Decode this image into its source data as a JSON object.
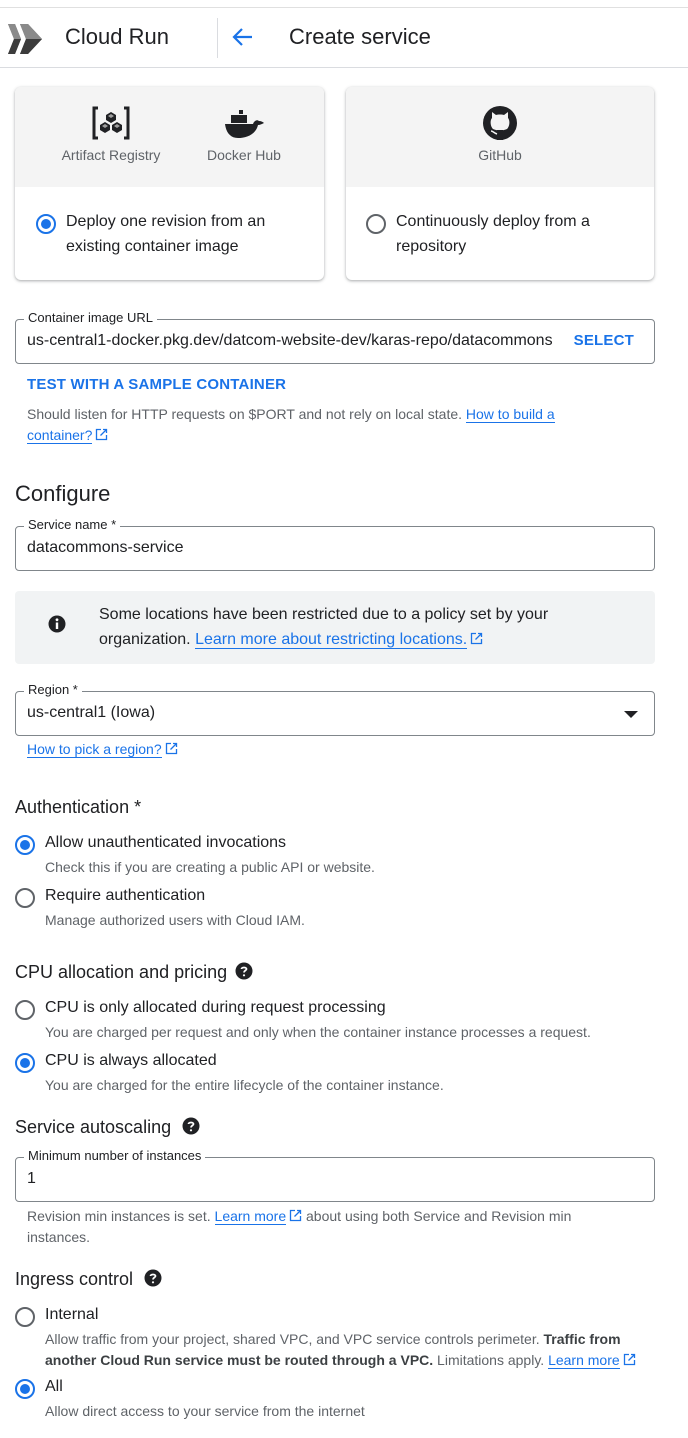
{
  "header": {
    "app_title": "Cloud Run",
    "page_title": "Create service",
    "back_icon": "arrow-back-icon",
    "logo_icon": "cloud-run-logo-icon"
  },
  "deploy_options": [
    {
      "sources": [
        {
          "icon": "artifact-registry-icon",
          "label": "Artifact Registry"
        },
        {
          "icon": "docker-hub-icon",
          "label": "Docker Hub"
        }
      ],
      "line1": "Deploy one revision from an",
      "line2": "existing container image",
      "selected": true
    },
    {
      "sources": [
        {
          "icon": "github-icon",
          "label": "GitHub"
        }
      ],
      "line1": "Continuously deploy from a",
      "line2": "repository",
      "selected": false
    }
  ],
  "container_image": {
    "label": "Container image URL",
    "value": "us-central1-docker.pkg.dev/datcom-website-dev/karas-repo/datacommons",
    "select_label": "SELECT",
    "test_label": "TEST WITH A SAMPLE CONTAINER",
    "hint_text": "Should listen for HTTP requests on $PORT and not rely on local state. ",
    "hint_link_1": "How to build a",
    "hint_link_2": "container?"
  },
  "configure": {
    "heading": "Configure",
    "service_name": {
      "label": "Service name *",
      "value": "datacommons-service"
    },
    "notice": {
      "icon": "info-icon",
      "text": "Some locations have been restricted due to a policy set by your organization. ",
      "link": "Learn more about restricting locations."
    },
    "region": {
      "label": "Region *",
      "value": "us-central1 (Iowa)",
      "help_link": "How to pick a region?"
    }
  },
  "authentication": {
    "heading": "Authentication *",
    "options": [
      {
        "label": "Allow unauthenticated invocations",
        "desc": "Check this if you are creating a public API or website.",
        "selected": true
      },
      {
        "label": "Require authentication",
        "desc": "Manage authorized users with Cloud IAM.",
        "selected": false
      }
    ]
  },
  "cpu": {
    "heading": "CPU allocation and pricing",
    "options": [
      {
        "label": "CPU is only allocated during request processing",
        "desc": "You are charged per request and only when the container instance processes a request.",
        "selected": false
      },
      {
        "label": "CPU is always allocated",
        "desc": "You are charged for the entire lifecycle of the container instance.",
        "selected": true
      }
    ]
  },
  "autoscaling": {
    "heading": "Service autoscaling",
    "min_instances": {
      "label": "Minimum number of instances",
      "value": "1"
    },
    "hint_before": "Revision min instances is set. ",
    "hint_link": "Learn more",
    "hint_after_1": " about using both Service and Revision min",
    "hint_after_2": "instances."
  },
  "ingress": {
    "heading": "Ingress control",
    "options": [
      {
        "label": "Internal",
        "desc_1a": "Allow traffic from your project, shared VPC, and VPC service controls perimeter. ",
        "desc_1b": "Traffic from",
        "desc_2a": "another Cloud Run service must be routed through a VPC.",
        "desc_2b": " Limitations apply. ",
        "desc_link": "Learn more",
        "selected": false
      },
      {
        "label": "All",
        "desc": "Allow direct access to your service from the internet",
        "selected": true
      }
    ]
  },
  "colors": {
    "accent": "#1a73e8",
    "text": "#202124",
    "secondary_text": "#5f6368"
  }
}
